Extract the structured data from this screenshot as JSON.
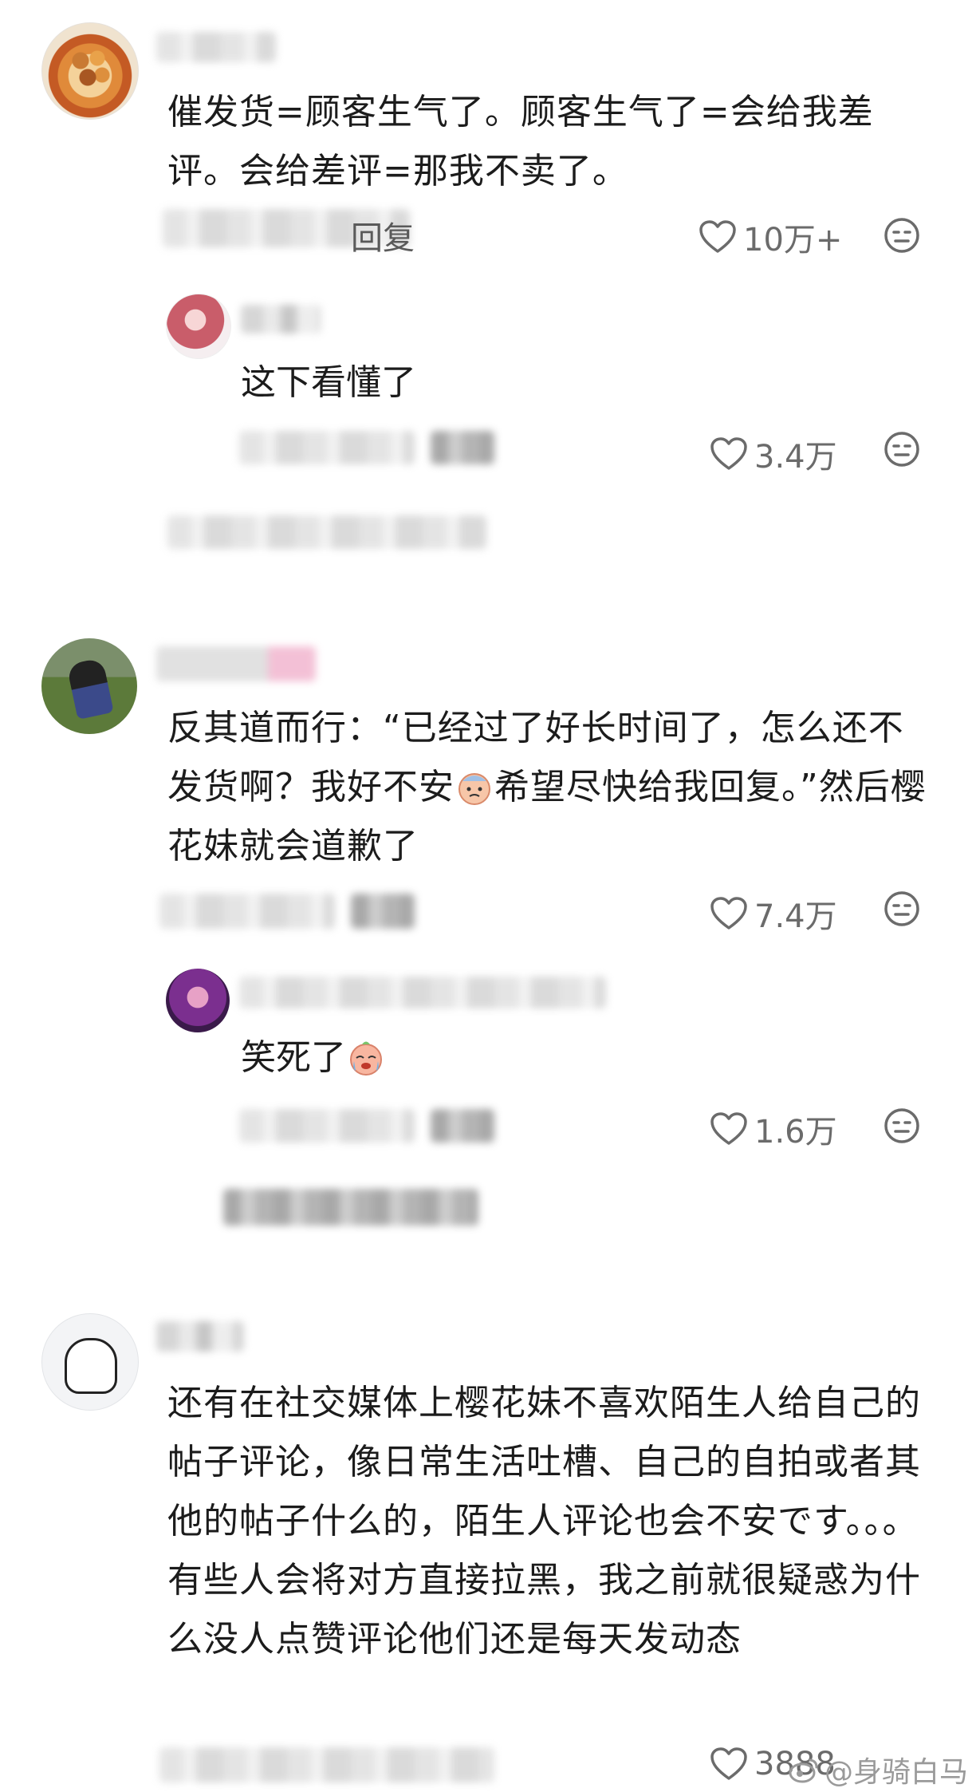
{
  "comments": [
    {
      "text": "催发货=顾客生气了。顾客生气了=会给我差评。会给差评=那我不卖了。",
      "reply_label": "回复",
      "likes": "10万+",
      "replies": [
        {
          "text": "这下看懂了",
          "likes": "3.4万"
        }
      ]
    },
    {
      "text_before_emoji": "反其道而行：“已经过了好长时间了，怎么还不发货啊？我好不安",
      "text_after_emoji": "希望尽快给我回复。”然后樱花妹就会道歉了",
      "likes": "7.4万",
      "replies": [
        {
          "text": "笑死了",
          "likes": "1.6万"
        }
      ]
    },
    {
      "text": "还有在社交媒体上樱花妹不喜欢陌生人给自己的帖子评论，像日常生活吐槽、自己的自拍或者其他的帖子什么的，陌生人评论也会不安です。。。有些人会将对方直接拉黑，我之前就很疑惑为什么没人点赞评论他们还是每天发动态",
      "likes": "3888"
    }
  ],
  "watermark": "@身骑白马",
  "colors": {
    "text": "#1c1c1c",
    "meta": "#6b6b6b",
    "background": "#ffffff"
  },
  "icons": [
    "heart-icon",
    "dislike-face-icon",
    "weibo-logo-icon"
  ]
}
